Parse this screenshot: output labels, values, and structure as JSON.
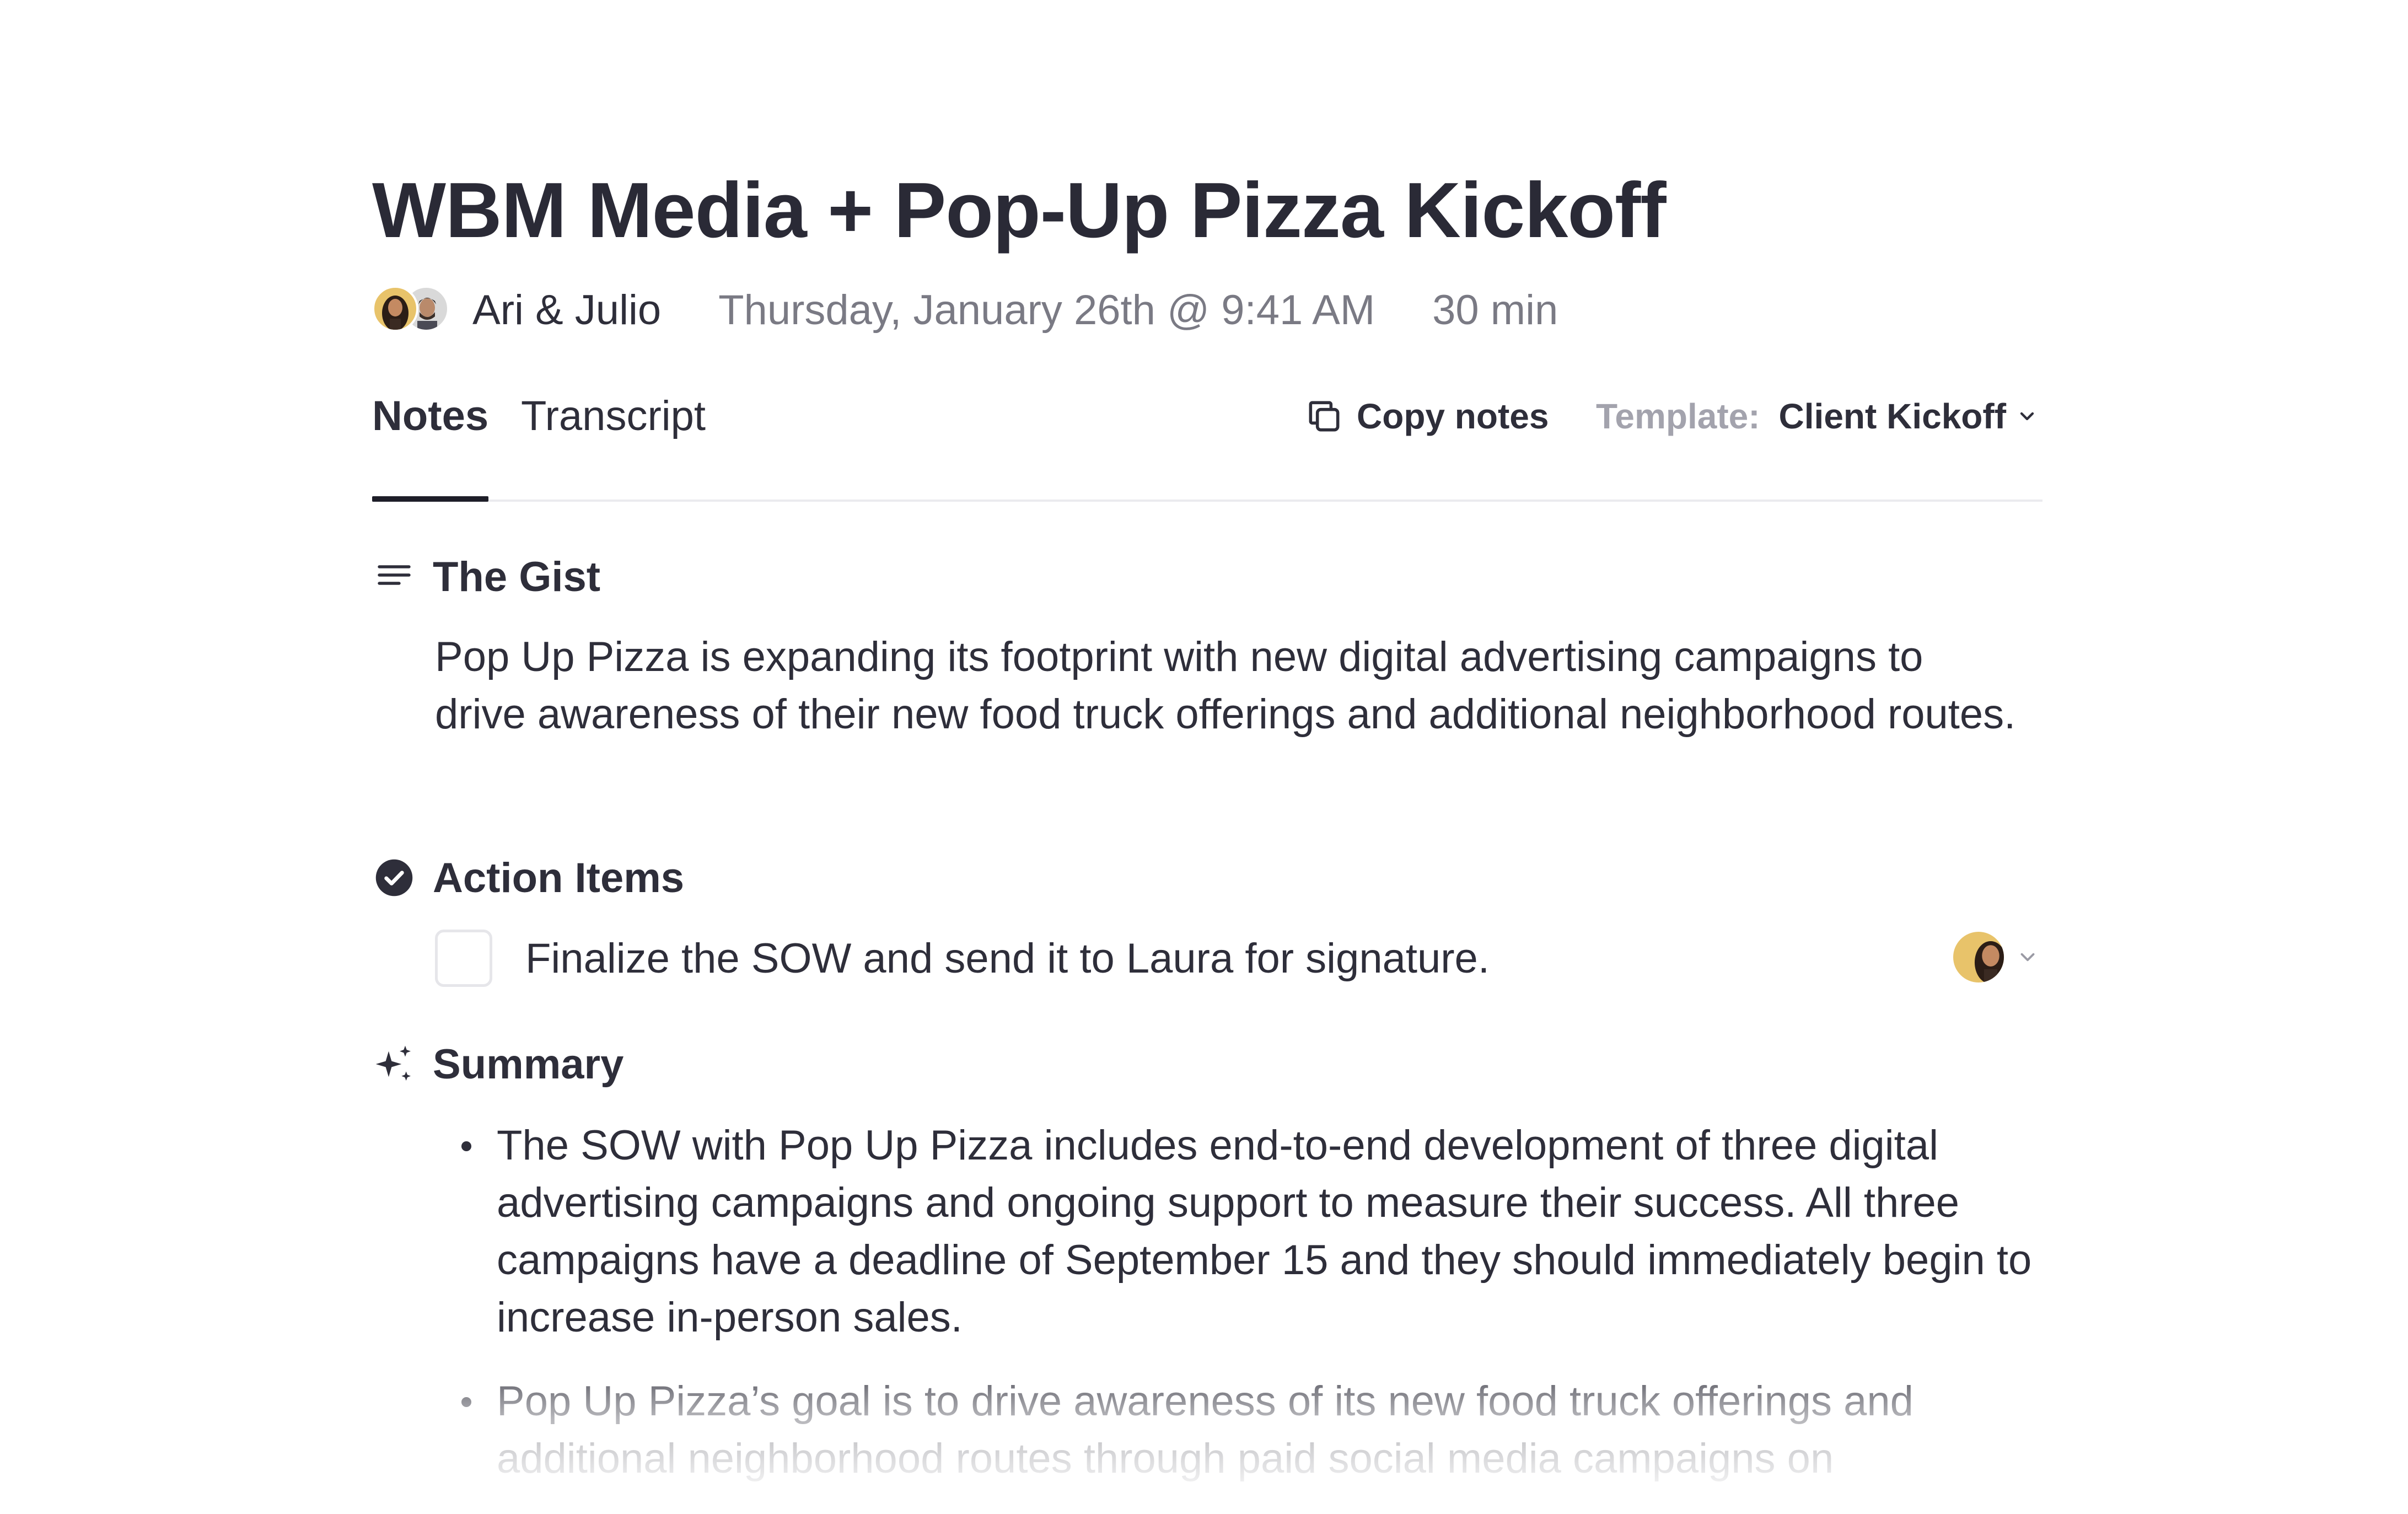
{
  "meeting": {
    "title": "WBM Media + Pop-Up Pizza Kickoff",
    "attendees": "Ari & Julio",
    "datetime": "Thursday, January 26th @ 9:41 AM",
    "duration": "30 min"
  },
  "tabs": {
    "notes": "Notes",
    "transcript": "Transcript",
    "active": "Notes"
  },
  "toolbar": {
    "copy_label": "Copy notes",
    "template_label": "Template:",
    "template_value": "Client Kickoff"
  },
  "sections": {
    "gist": {
      "icon": "lines-icon",
      "heading": "The Gist",
      "text": "Pop Up Pizza is expanding its footprint with new digital advertising campaigns to drive awareness of their new food truck offerings and additional neighborhood routes."
    },
    "action_items": {
      "icon": "check-circle-icon",
      "heading": "Action Items",
      "items": [
        {
          "text": "Finalize the SOW and send it to Laura for signature.",
          "checked": false
        }
      ]
    },
    "summary": {
      "icon": "sparkles-icon",
      "heading": "Summary",
      "bullets": [
        "The SOW with Pop Up Pizza includes end-to-end development of three digital advertising campaigns and ongoing support to measure their success. All three campaigns have a deadline of September 15 and they should immediately begin to increase in-person sales.",
        "Pop Up Pizza’s goal is to drive awareness of its new food truck offerings and additional neighborhood routes through paid social media campaigns on"
      ]
    }
  },
  "colors": {
    "text": "#2e2e3a",
    "muted": "#7a7a84",
    "template_label": "#a3a3ad",
    "divider": "#ebebee",
    "avatar_yellow": "#e8c36a"
  }
}
